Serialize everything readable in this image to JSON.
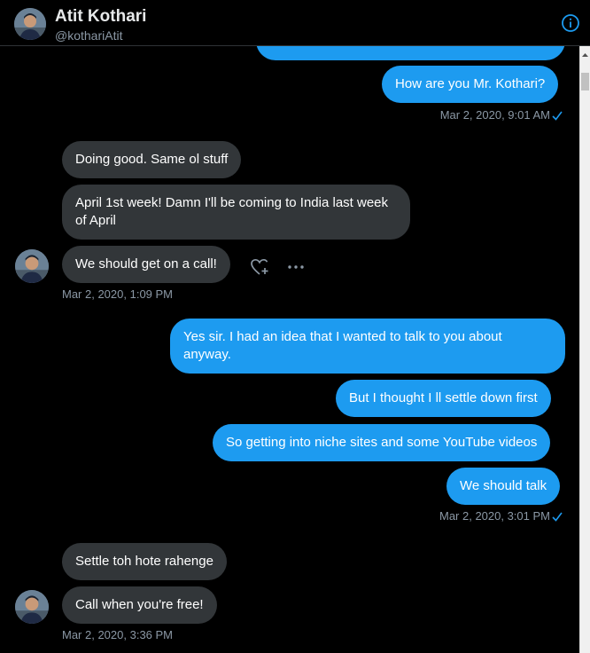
{
  "header": {
    "name": "Atit Kothari",
    "handle": "@kothariAtit"
  },
  "messages": {
    "m0": {
      "text": ""
    },
    "m1": {
      "text": "How are you Mr. Kothari?",
      "timestamp": "Mar 2, 2020, 9:01 AM"
    },
    "m2": {
      "text": "Doing good. Same ol stuff"
    },
    "m3": {
      "text": "April 1st week! Damn I'll be coming to India last week of April"
    },
    "m4": {
      "text": "We should get on a call!",
      "timestamp": "Mar 2, 2020, 1:09 PM"
    },
    "m5": {
      "text": "Yes sir. I had an idea that I wanted to talk to you about anyway."
    },
    "m6": {
      "text": "But I thought I ll settle down first"
    },
    "m7": {
      "text": "So getting into niche sites and some YouTube videos"
    },
    "m8": {
      "text": "We should talk",
      "timestamp": "Mar 2, 2020, 3:01 PM"
    },
    "m9": {
      "text": "Settle toh hote rahenge"
    },
    "m10": {
      "text": "Call when you're free!",
      "timestamp": "Mar 2, 2020, 3:36 PM"
    }
  },
  "colors": {
    "background": "#000000",
    "outgoing_bubble": "#1d9bf0",
    "incoming_bubble": "#323639",
    "muted_text": "#8b98a5",
    "accent": "#1d9bf0"
  },
  "icons": {
    "info": "info-icon",
    "read_receipt": "check-icon",
    "react": "heart-plus-icon",
    "more": "more-icon"
  }
}
